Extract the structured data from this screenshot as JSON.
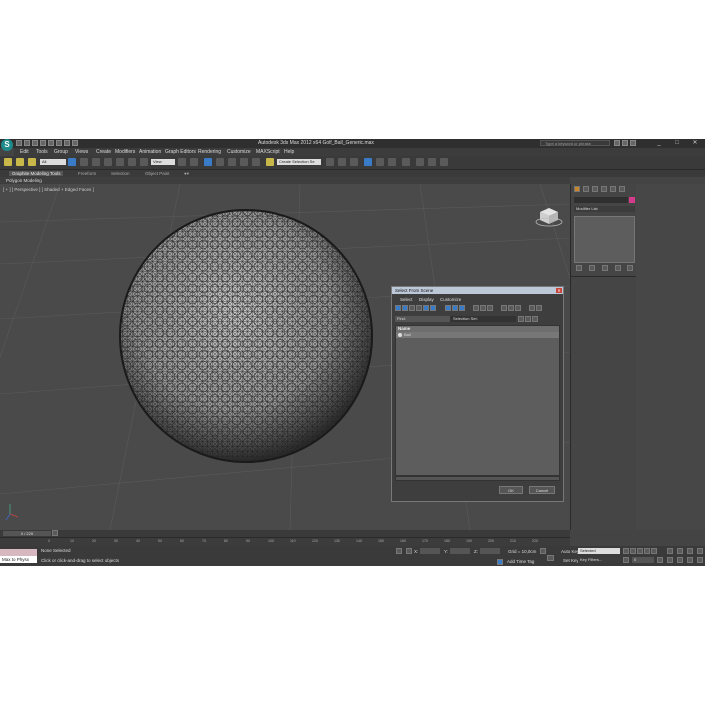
{
  "app": {
    "title": "Autodesk 3ds Max 2012 x64    Golf_Ball_Generic.max",
    "logo": "3ds Max logo",
    "search_placeholder": "Type a keyword or phrase",
    "window_controls": [
      "_",
      "□",
      "✕"
    ]
  },
  "menu": [
    "Edit",
    "Tools",
    "Group",
    "Views",
    "Create",
    "Modifiers",
    "Animation",
    "Graph Editors",
    "Rendering",
    "Customize",
    "MAXScript",
    "Help"
  ],
  "toolbar": {
    "filter_dropdown": "All",
    "refcoord_dropdown": "View",
    "selection_set": "Create Selection Se"
  },
  "ribbon": {
    "tabs": [
      "Graphite Modeling Tools",
      "Freeform",
      "Selection",
      "Object Paint"
    ],
    "active_tab": "Graphite Modeling Tools",
    "sub_label": "Polygon Modeling"
  },
  "viewport": {
    "label": "[ + ] [ Perspective ] [ Shaded + Edged Faces ]",
    "object": "golf ball wireframe",
    "axis_gizmo": "x y z"
  },
  "command_panel": {
    "tab_icons": [
      "create-icon",
      "modify-icon",
      "hierarchy-icon",
      "motion-icon",
      "display-icon",
      "utilities-icon"
    ],
    "modifier_list": "Modifier List",
    "color_swatch": "#d63a8c"
  },
  "dialog": {
    "title": "Select From Scene",
    "close": "✕",
    "menu": [
      "Select",
      "Display",
      "Customize"
    ],
    "find_label": "Find:",
    "selection_sets_label": "Selection Set:",
    "column_header": "Name",
    "rows": [
      "Ball"
    ],
    "ok": "OK",
    "cancel": "Cancel"
  },
  "timeline": {
    "frame_label": "0 / 225",
    "ticks": [
      "0",
      "10",
      "20",
      "30",
      "40",
      "50",
      "60",
      "70",
      "80",
      "90",
      "100",
      "110",
      "120",
      "130",
      "140",
      "150",
      "160",
      "170",
      "180",
      "190",
      "200",
      "210",
      "220"
    ]
  },
  "status": {
    "maxscript_text": "Max to Physx",
    "none_selected": "None Selected",
    "prompt": "Click or click-and-drag to select objects",
    "x_label": "X:",
    "y_label": "Y:",
    "z_label": "Z:",
    "grid": "Grid = 10,0cm",
    "add_time_tag": "Add Time Tag",
    "auto_key": "Auto Key",
    "auto_key_dropdown": "Selected",
    "set_key": "Set Key",
    "key_filters": "Key Filters...",
    "frame_field": "0"
  },
  "colors": {
    "app_bg": "#444444",
    "accent_blue": "#3a7bc8",
    "dialog_title": "#bcc8d8",
    "maxscript_pink": "#d8b8c0"
  }
}
